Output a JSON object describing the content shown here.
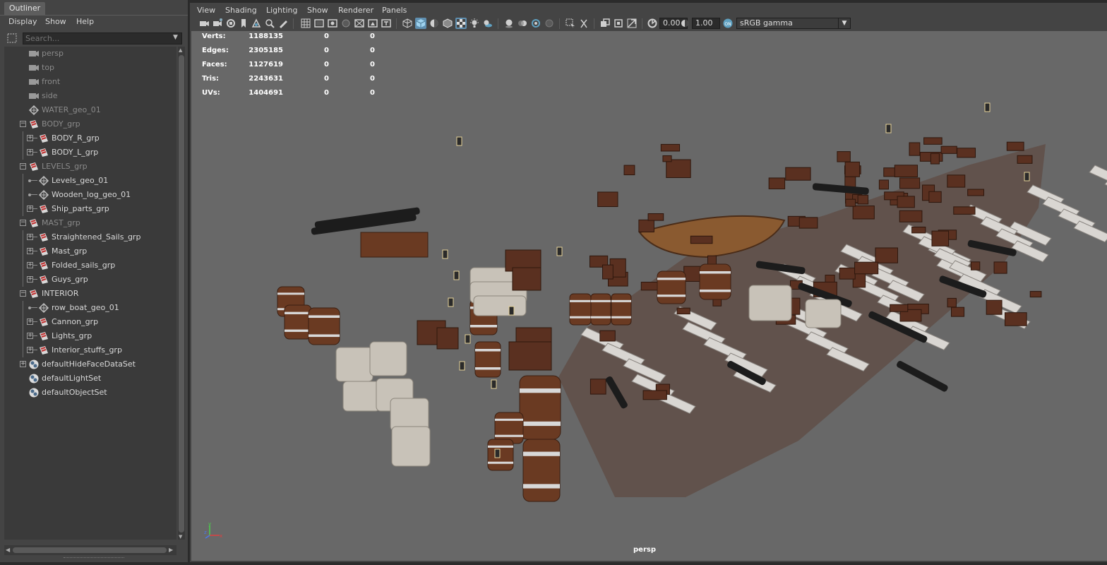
{
  "outliner": {
    "tab": "Outliner",
    "menu": [
      "Display",
      "Show",
      "Help"
    ],
    "search_placeholder": "Search...",
    "rows": [
      {
        "label": "persp",
        "kind": "camera",
        "depth": 0,
        "expand": "",
        "dim": true
      },
      {
        "label": "top",
        "kind": "camera",
        "depth": 0,
        "expand": "",
        "dim": true
      },
      {
        "label": "front",
        "kind": "camera",
        "depth": 0,
        "expand": "",
        "dim": true
      },
      {
        "label": "side",
        "kind": "camera",
        "depth": 0,
        "expand": "",
        "dim": true
      },
      {
        "label": "WATER_geo_01",
        "kind": "mesh",
        "depth": 0,
        "expand": "",
        "dim": true
      },
      {
        "label": "BODY_grp",
        "kind": "group",
        "depth": 0,
        "expand": "-",
        "dim": true
      },
      {
        "label": "BODY_R_grp",
        "kind": "group",
        "depth": 1,
        "expand": "+",
        "dim": false
      },
      {
        "label": "BODY_L_grp",
        "kind": "group",
        "depth": 1,
        "expand": "+",
        "dim": false
      },
      {
        "label": "LEVELS_grp",
        "kind": "group",
        "depth": 0,
        "expand": "-",
        "dim": true
      },
      {
        "label": "Levels_geo_01",
        "kind": "mesh",
        "depth": 1,
        "expand": "dot",
        "dim": false
      },
      {
        "label": "Wooden_log_geo_01",
        "kind": "mesh",
        "depth": 1,
        "expand": "dot",
        "dim": false
      },
      {
        "label": "Ship_parts_grp",
        "kind": "group",
        "depth": 1,
        "expand": "+",
        "dim": false
      },
      {
        "label": "MAST_grp",
        "kind": "group",
        "depth": 0,
        "expand": "-",
        "dim": true
      },
      {
        "label": "Straightened_Sails_grp",
        "kind": "group",
        "depth": 1,
        "expand": "+",
        "dim": false
      },
      {
        "label": "Mast_grp",
        "kind": "group",
        "depth": 1,
        "expand": "+",
        "dim": false
      },
      {
        "label": "Folded_sails_grp",
        "kind": "group",
        "depth": 1,
        "expand": "+",
        "dim": false
      },
      {
        "label": "Guys_grp",
        "kind": "group",
        "depth": 1,
        "expand": "+",
        "dim": false
      },
      {
        "label": "INTERIOR",
        "kind": "group",
        "depth": 0,
        "expand": "-",
        "dim": false
      },
      {
        "label": "row_boat_geo_01",
        "kind": "mesh",
        "depth": 1,
        "expand": "dot",
        "dim": false
      },
      {
        "label": "Cannon_grp",
        "kind": "group",
        "depth": 1,
        "expand": "+",
        "dim": false
      },
      {
        "label": "Lights_grp",
        "kind": "group",
        "depth": 1,
        "expand": "+",
        "dim": false
      },
      {
        "label": "Interior_stuffs_grp",
        "kind": "group",
        "depth": 1,
        "expand": "+",
        "dim": false
      },
      {
        "label": "defaultHideFaceDataSet",
        "kind": "set",
        "depth": 0,
        "expand": "+",
        "dim": false
      },
      {
        "label": "defaultLightSet",
        "kind": "set",
        "depth": 0,
        "expand": "",
        "dim": false
      },
      {
        "label": "defaultObjectSet",
        "kind": "set",
        "depth": 0,
        "expand": "",
        "dim": false
      }
    ]
  },
  "viewport": {
    "menu": [
      "View",
      "Shading",
      "Lighting",
      "Show",
      "Renderer",
      "Panels"
    ],
    "exposure": "0.00",
    "gamma": "1.00",
    "color_space": "sRGB gamma",
    "camera": "persp",
    "hud": [
      {
        "label": "Verts:",
        "total": "1188135",
        "selected": "0",
        "components": "0"
      },
      {
        "label": "Edges:",
        "total": "2305185",
        "selected": "0",
        "components": "0"
      },
      {
        "label": "Faces:",
        "total": "1127619",
        "selected": "0",
        "components": "0"
      },
      {
        "label": "Tris:",
        "total": "2243631",
        "selected": "0",
        "components": "0"
      },
      {
        "label": "UVs:",
        "total": "1404691",
        "selected": "0",
        "components": "0"
      }
    ],
    "axis_labels": [
      "y",
      "x",
      "z"
    ]
  },
  "colors": {
    "panel_bg": "#444444",
    "viewport_bg": "#686868",
    "wood": "#6a3a22",
    "sack": "#c8c2b8",
    "toggle_on": "#5f8fb0"
  }
}
